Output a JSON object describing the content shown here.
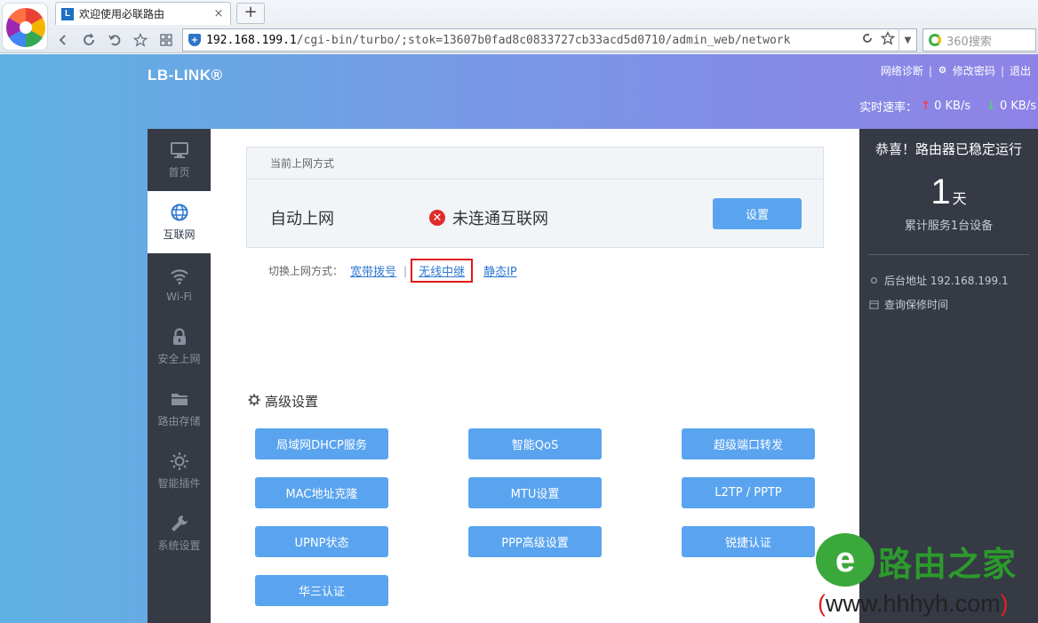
{
  "browser": {
    "tab_title": "欢迎使用必联路由",
    "tab_close": "×",
    "new_tab": "+",
    "url_host": "192.168.199.1",
    "url_path": "/cgi-bin/turbo/;stok=13607b0fad8c0833727cb33acd5d0710/admin_web/network",
    "search_placeholder": "360搜索"
  },
  "header": {
    "brand": "LB-LINK®",
    "links": {
      "diag": "网络诊断",
      "change_pwd": "修改密码",
      "logout": "退出"
    },
    "speed_label": "实时速率：",
    "upload": "0 KB/s",
    "download": "0 KB/s"
  },
  "sidebar": {
    "items": [
      {
        "label": "首页",
        "icon": "monitor-icon"
      },
      {
        "label": "互联网",
        "icon": "globe-icon",
        "active": true
      },
      {
        "label": "Wi-Fi",
        "icon": "wifi-icon"
      },
      {
        "label": "安全上网",
        "icon": "lock-icon"
      },
      {
        "label": "路由存储",
        "icon": "folder-icon"
      },
      {
        "label": "智能插件",
        "icon": "lightbulb-icon"
      },
      {
        "label": "系统设置",
        "icon": "wrench-icon"
      }
    ]
  },
  "main": {
    "current_mode_header": "当前上网方式",
    "mode": "自动上网",
    "connection_status": "未连通互联网",
    "setup_button": "设置",
    "switch_label": "切换上网方式：",
    "switch_options": [
      "宽带拨号",
      "无线中继",
      "静态IP"
    ],
    "advanced_title": "高级设置",
    "advanced_buttons": [
      "局域网DHCP服务",
      "智能QoS",
      "超级端口转发",
      "MAC地址克隆",
      "MTU设置",
      "L2TP / PPTP",
      "UPNP状态",
      "PPP高级设置",
      "锐捷认证",
      "华三认证"
    ]
  },
  "right_panel": {
    "title": "恭喜！路由器已稳定运行",
    "days": "1",
    "days_unit": "天",
    "served": "累计服务1台设备",
    "admin_address": "后台地址 192.168.199.1",
    "warranty": "查询保修时间"
  },
  "watermark": {
    "logo_letter": "e",
    "name": "路由之家",
    "url": "www.hhhyh.com",
    "paren_open": "(",
    "paren_close": ")"
  },
  "colors": {
    "accent_button": "#5aa4ef",
    "sidebar_bg": "#353a45",
    "error": "#e02b2b",
    "highlight_box": "#e01818"
  }
}
